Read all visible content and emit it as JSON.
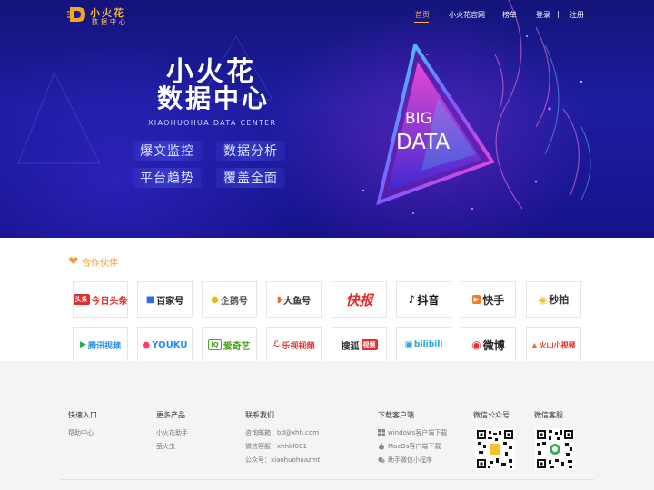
{
  "header": {
    "logo_title": "小火花",
    "logo_subtitle": "数据中心",
    "nav": [
      "首页",
      "小火花官网",
      "榜单",
      "登录",
      "|",
      "注册"
    ],
    "active_nav": "首页"
  },
  "hero": {
    "title_line1": "小火花",
    "title_line2": "数据中心",
    "subtitle": "XIAOHUOHUA DATA CENTER",
    "pills": [
      "爆文监控",
      "数据分析",
      "平台趋势",
      "覆盖全面"
    ],
    "big": "BIG",
    "data": "DATA"
  },
  "partners": {
    "title": "合作伙伴",
    "logos": [
      {
        "badge": "头条",
        "text": "今日头条"
      },
      {
        "badge": "",
        "text": "百家号"
      },
      {
        "badge": "",
        "text": "企鹅号"
      },
      {
        "badge": "",
        "text": "大鱼号"
      },
      {
        "badge": "",
        "text": "快报"
      },
      {
        "badge": "",
        "text": "抖音"
      },
      {
        "badge": "",
        "text": "快手"
      },
      {
        "badge": "",
        "text": "秒拍"
      },
      {
        "badge": "",
        "text": "腾讯视频"
      },
      {
        "badge": "",
        "text": "YOUKU"
      },
      {
        "badge": "",
        "text": "爱奇艺"
      },
      {
        "badge": "",
        "text": "乐视视频"
      },
      {
        "badge": "视频",
        "text": "搜狐"
      },
      {
        "badge": "",
        "text": "bilibili"
      },
      {
        "badge": "",
        "text": "微博"
      },
      {
        "badge": "",
        "text": "火山小视频"
      }
    ]
  },
  "footer": {
    "quick": {
      "title": "快速入口",
      "links": [
        "帮助中心"
      ]
    },
    "products": {
      "title": "更多产品",
      "links": [
        "小火花助手",
        "萤火虫"
      ]
    },
    "contact": {
      "title": "联系我们",
      "lines": [
        "咨询邮箱：bd@xhh.com",
        "微信客服：xhhkf001",
        "公众号：xiaohuohuazmt"
      ]
    },
    "download": {
      "title": "下载客户端",
      "items": [
        "windows客户端下载",
        "MacOs客户端下载",
        "助手微信小程序"
      ]
    },
    "wechat_public": {
      "title": "微信公众号"
    },
    "wechat_service": {
      "title": "微信客服"
    }
  },
  "colors": {
    "accent": "#ffb13b",
    "partner_title": "#f39a2d",
    "hero_bg": "#1a1b96"
  }
}
